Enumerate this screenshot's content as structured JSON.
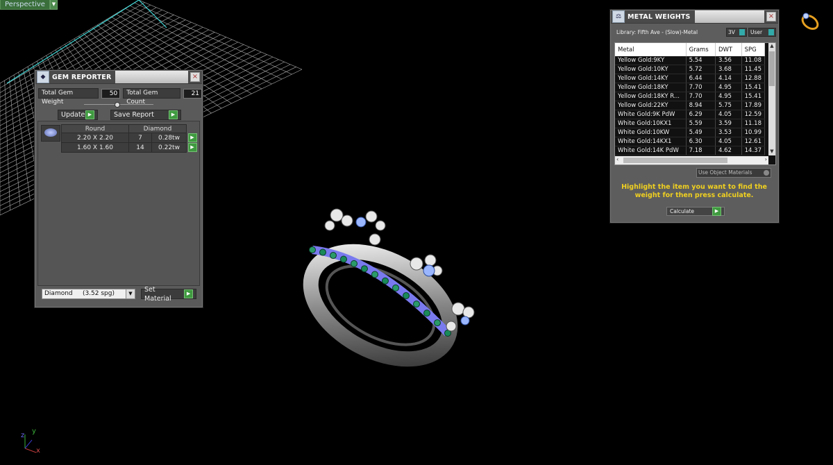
{
  "viewport": {
    "label": "Perspective",
    "axis_y": "y",
    "axis_z": "z",
    "axis_x": "x",
    "grid_color": "#d8d8d8",
    "axis_color": "#40e0e0"
  },
  "gem_reporter": {
    "title": "GEM REPORTER",
    "total_weight_label": "Total Gem Weight",
    "total_weight_value": "50",
    "total_count_label": "Total Gem Count",
    "total_count_value": "21",
    "update_label": "Update",
    "save_report_label": "Save Report",
    "col_shape": "Round",
    "col_material": "Diamond",
    "rows": [
      {
        "size": "2.20 X 2.20",
        "count": "7",
        "weight": "0.28tw"
      },
      {
        "size": "1.60 X 1.60",
        "count": "14",
        "weight": "0.22tw"
      }
    ],
    "material_select": "Diamond     (3.52 spg)",
    "set_material_label": "Set Material"
  },
  "metal_weights": {
    "title": "METAL WEIGHTS",
    "library_label": "Library: Fifth Ave - (Slow)-Metal",
    "btn_3v": "3V",
    "btn_user": "User",
    "columns": [
      "Metal",
      "Grams",
      "DWT",
      "SPG"
    ],
    "rows": [
      [
        "Yellow Gold:9KY",
        "5.54",
        "3.56",
        "11.08"
      ],
      [
        "Yellow Gold:10KY",
        "5.72",
        "3.68",
        "11.45"
      ],
      [
        "Yellow Gold:14KY",
        "6.44",
        "4.14",
        "12.88"
      ],
      [
        "Yellow Gold:18KY",
        "7.70",
        "4.95",
        "15.41"
      ],
      [
        "Yellow Gold:18KY R...",
        "7.70",
        "4.95",
        "15.41"
      ],
      [
        "Yellow Gold:22KY",
        "8.94",
        "5.75",
        "17.89"
      ],
      [
        "White Gold:9K PdW",
        "6.29",
        "4.05",
        "12.59"
      ],
      [
        "White Gold:10KX1",
        "5.59",
        "3.59",
        "11.18"
      ],
      [
        "White Gold:10KW",
        "5.49",
        "3.53",
        "10.99"
      ],
      [
        "White Gold:14KX1",
        "6.30",
        "4.05",
        "12.61"
      ],
      [
        "White Gold:14K PdW",
        "7.18",
        "4.62",
        "14.37"
      ]
    ],
    "use_object_materials": "Use Object Materials",
    "instruction": "Highlight the item you want to find the weight for then press calculate.",
    "calculate_label": "Calculate"
  }
}
